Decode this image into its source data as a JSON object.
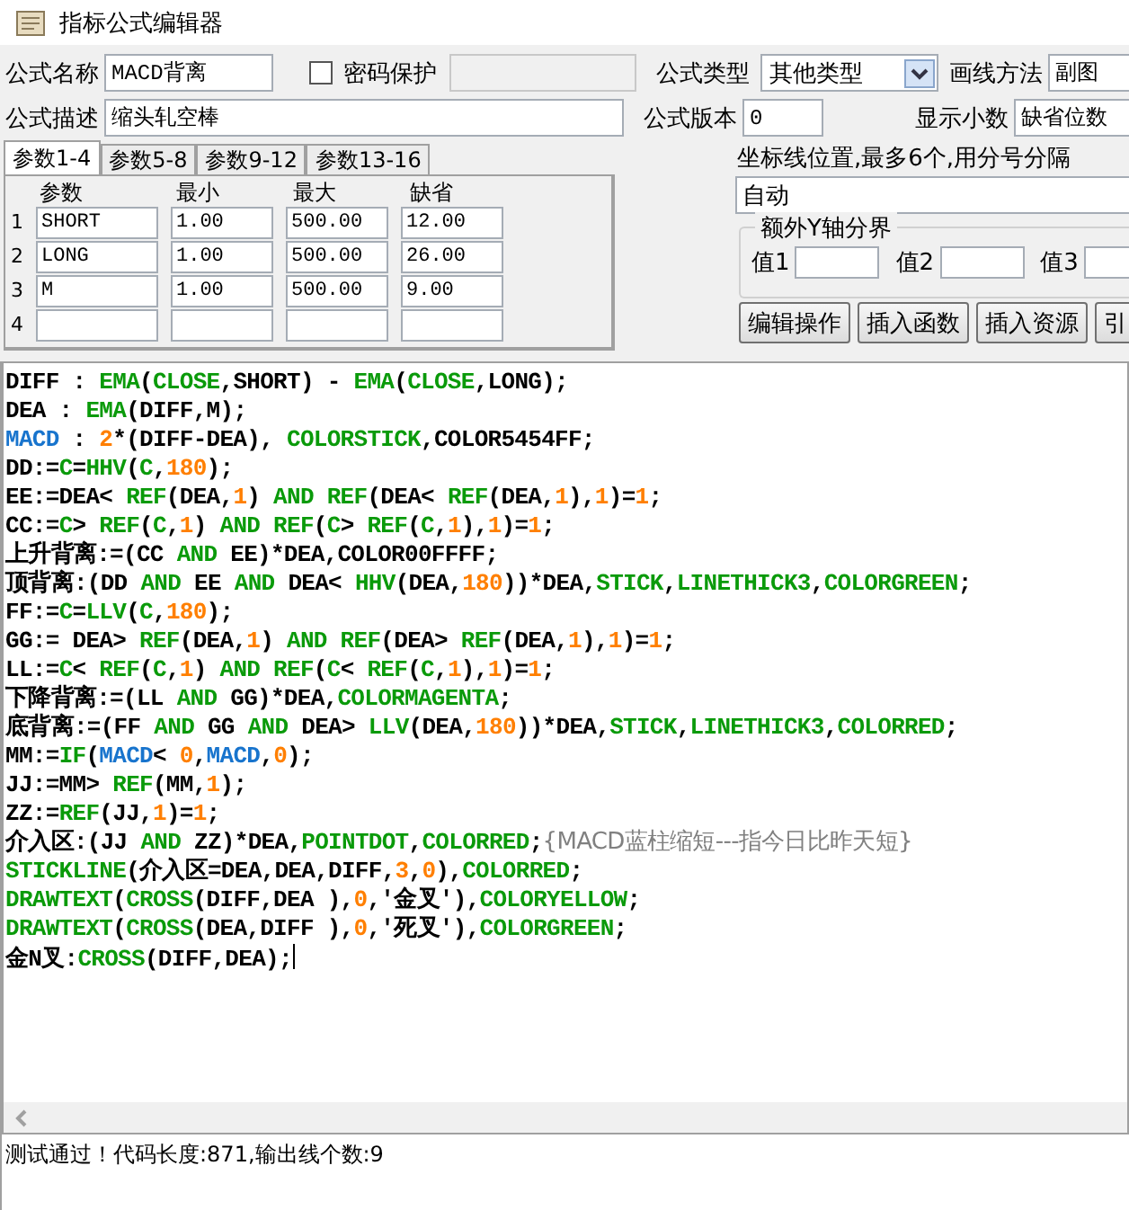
{
  "window": {
    "title": "指标公式编辑器"
  },
  "form": {
    "name_label": "公式名称",
    "name": "MACD背离",
    "password": {
      "label": "密码保护",
      "checked": false
    },
    "type_label": "公式类型",
    "type": "其他类型",
    "draw_label": "画线方法",
    "draw": "副图",
    "desc_label": "公式描述",
    "desc": "缩头轧空棒",
    "version_label": "公式版本",
    "version": "0",
    "decimals_label": "显示小数",
    "decimals": "缺省位数"
  },
  "param_tabs": [
    {
      "label": "参数1-4",
      "selected": true
    },
    {
      "label": "参数5-8",
      "selected": false
    },
    {
      "label": "参数9-12",
      "selected": false
    },
    {
      "label": "参数13-16",
      "selected": false
    }
  ],
  "param_table": {
    "columns": [
      "参数",
      "最小",
      "最大",
      "缺省"
    ],
    "rows": [
      {
        "index": "1",
        "cells": [
          "SHORT",
          "1.00",
          "500.00",
          "12.00"
        ]
      },
      {
        "index": "2",
        "cells": [
          "LONG",
          "1.00",
          "500.00",
          "26.00"
        ]
      },
      {
        "index": "3",
        "cells": [
          "M",
          "1.00",
          "500.00",
          "9.00"
        ]
      },
      {
        "index": "4"
      }
    ]
  },
  "axis": {
    "label": "坐标线位置,最多6个,用分号分隔",
    "value": "自动"
  },
  "y_split": {
    "title": "额外Y轴分界",
    "fields": [
      {
        "label": "值1"
      },
      {
        "label": "值2"
      },
      {
        "label": "值3"
      }
    ]
  },
  "buttons": [
    "编辑操作",
    "插入函数",
    "插入资源",
    "引"
  ],
  "code": [
    [
      {
        "kind": "plain",
        "text": "DIFF : "
      },
      {
        "kind": "func",
        "text": "EMA"
      },
      {
        "kind": "plain",
        "text": "("
      },
      {
        "kind": "func",
        "text": "CLOSE"
      },
      {
        "kind": "plain",
        "text": ",SHORT) - "
      },
      {
        "kind": "func",
        "text": "EMA"
      },
      {
        "kind": "plain",
        "text": "("
      },
      {
        "kind": "func",
        "text": "CLOSE"
      },
      {
        "kind": "plain",
        "text": ",LONG);"
      }
    ],
    [
      {
        "kind": "plain",
        "text": "DEA : "
      },
      {
        "kind": "func",
        "text": "EMA"
      },
      {
        "kind": "plain",
        "text": "(DIFF,M);"
      }
    ],
    [
      {
        "kind": "var",
        "text": "MACD"
      },
      {
        "kind": "plain",
        "text": " : "
      },
      {
        "kind": "num",
        "text": "2"
      },
      {
        "kind": "plain",
        "text": "*(DIFF-DEA), "
      },
      {
        "kind": "func",
        "text": "COLORSTICK"
      },
      {
        "kind": "plain",
        "text": ",COLOR5454FF;"
      }
    ],
    [
      {
        "kind": "plain",
        "text": "DD:="
      },
      {
        "kind": "func",
        "text": "C"
      },
      {
        "kind": "plain",
        "text": "="
      },
      {
        "kind": "func",
        "text": "HHV"
      },
      {
        "kind": "plain",
        "text": "("
      },
      {
        "kind": "func",
        "text": "C"
      },
      {
        "kind": "plain",
        "text": ","
      },
      {
        "kind": "num",
        "text": "180"
      },
      {
        "kind": "plain",
        "text": ");"
      }
    ],
    [
      {
        "kind": "plain",
        "text": "EE:=DEA< "
      },
      {
        "kind": "func",
        "text": "REF"
      },
      {
        "kind": "plain",
        "text": "(DEA,"
      },
      {
        "kind": "num",
        "text": "1"
      },
      {
        "kind": "plain",
        "text": ") "
      },
      {
        "kind": "func",
        "text": "AND REF"
      },
      {
        "kind": "plain",
        "text": "(DEA< "
      },
      {
        "kind": "func",
        "text": "REF"
      },
      {
        "kind": "plain",
        "text": "(DEA,"
      },
      {
        "kind": "num",
        "text": "1"
      },
      {
        "kind": "plain",
        "text": "),"
      },
      {
        "kind": "num",
        "text": "1"
      },
      {
        "kind": "plain",
        "text": ")="
      },
      {
        "kind": "num",
        "text": "1"
      },
      {
        "kind": "plain",
        "text": ";"
      }
    ],
    [
      {
        "kind": "plain",
        "text": "CC:="
      },
      {
        "kind": "func",
        "text": "C"
      },
      {
        "kind": "plain",
        "text": "> "
      },
      {
        "kind": "func",
        "text": "REF"
      },
      {
        "kind": "plain",
        "text": "("
      },
      {
        "kind": "func",
        "text": "C"
      },
      {
        "kind": "plain",
        "text": ","
      },
      {
        "kind": "num",
        "text": "1"
      },
      {
        "kind": "plain",
        "text": ") "
      },
      {
        "kind": "func",
        "text": "AND REF"
      },
      {
        "kind": "plain",
        "text": "("
      },
      {
        "kind": "func",
        "text": "C"
      },
      {
        "kind": "plain",
        "text": "> "
      },
      {
        "kind": "func",
        "text": "REF"
      },
      {
        "kind": "plain",
        "text": "("
      },
      {
        "kind": "func",
        "text": "C"
      },
      {
        "kind": "plain",
        "text": ","
      },
      {
        "kind": "num",
        "text": "1"
      },
      {
        "kind": "plain",
        "text": "),"
      },
      {
        "kind": "num",
        "text": "1"
      },
      {
        "kind": "plain",
        "text": ")="
      },
      {
        "kind": "num",
        "text": "1"
      },
      {
        "kind": "plain",
        "text": ";"
      }
    ],
    [
      {
        "kind": "plain",
        "text": "上升背离:=(CC "
      },
      {
        "kind": "func",
        "text": "AND"
      },
      {
        "kind": "plain",
        "text": " EE)*DEA,COLOR00FFFF;"
      }
    ],
    [
      {
        "kind": "plain",
        "text": "顶背离:(DD "
      },
      {
        "kind": "func",
        "text": "AND"
      },
      {
        "kind": "plain",
        "text": " EE "
      },
      {
        "kind": "func",
        "text": "AND"
      },
      {
        "kind": "plain",
        "text": " DEA< "
      },
      {
        "kind": "func",
        "text": "HHV"
      },
      {
        "kind": "plain",
        "text": "(DEA,"
      },
      {
        "kind": "num",
        "text": "180"
      },
      {
        "kind": "plain",
        "text": "))*DEA,"
      },
      {
        "kind": "func",
        "text": "STICK"
      },
      {
        "kind": "plain",
        "text": ","
      },
      {
        "kind": "func",
        "text": "LINETHICK3"
      },
      {
        "kind": "plain",
        "text": ","
      },
      {
        "kind": "func",
        "text": "COLORGREEN"
      },
      {
        "kind": "plain",
        "text": ";"
      }
    ],
    [
      {
        "kind": "plain",
        "text": "FF:="
      },
      {
        "kind": "func",
        "text": "C"
      },
      {
        "kind": "plain",
        "text": "="
      },
      {
        "kind": "func",
        "text": "LLV"
      },
      {
        "kind": "plain",
        "text": "("
      },
      {
        "kind": "func",
        "text": "C"
      },
      {
        "kind": "plain",
        "text": ","
      },
      {
        "kind": "num",
        "text": "180"
      },
      {
        "kind": "plain",
        "text": ");"
      }
    ],
    [
      {
        "kind": "plain",
        "text": "GG:= DEA> "
      },
      {
        "kind": "func",
        "text": "REF"
      },
      {
        "kind": "plain",
        "text": "(DEA,"
      },
      {
        "kind": "num",
        "text": "1"
      },
      {
        "kind": "plain",
        "text": ") "
      },
      {
        "kind": "func",
        "text": "AND REF"
      },
      {
        "kind": "plain",
        "text": "(DEA> "
      },
      {
        "kind": "func",
        "text": "REF"
      },
      {
        "kind": "plain",
        "text": "(DEA,"
      },
      {
        "kind": "num",
        "text": "1"
      },
      {
        "kind": "plain",
        "text": "),"
      },
      {
        "kind": "num",
        "text": "1"
      },
      {
        "kind": "plain",
        "text": ")="
      },
      {
        "kind": "num",
        "text": "1"
      },
      {
        "kind": "plain",
        "text": ";"
      }
    ],
    [
      {
        "kind": "plain",
        "text": "LL:="
      },
      {
        "kind": "func",
        "text": "C"
      },
      {
        "kind": "plain",
        "text": "< "
      },
      {
        "kind": "func",
        "text": "REF"
      },
      {
        "kind": "plain",
        "text": "("
      },
      {
        "kind": "func",
        "text": "C"
      },
      {
        "kind": "plain",
        "text": ","
      },
      {
        "kind": "num",
        "text": "1"
      },
      {
        "kind": "plain",
        "text": ") "
      },
      {
        "kind": "func",
        "text": "AND REF"
      },
      {
        "kind": "plain",
        "text": "("
      },
      {
        "kind": "func",
        "text": "C"
      },
      {
        "kind": "plain",
        "text": "< "
      },
      {
        "kind": "func",
        "text": "REF"
      },
      {
        "kind": "plain",
        "text": "("
      },
      {
        "kind": "func",
        "text": "C"
      },
      {
        "kind": "plain",
        "text": ","
      },
      {
        "kind": "num",
        "text": "1"
      },
      {
        "kind": "plain",
        "text": "),"
      },
      {
        "kind": "num",
        "text": "1"
      },
      {
        "kind": "plain",
        "text": ")="
      },
      {
        "kind": "num",
        "text": "1"
      },
      {
        "kind": "plain",
        "text": ";"
      }
    ],
    [
      {
        "kind": "plain",
        "text": "下降背离:=(LL "
      },
      {
        "kind": "func",
        "text": "AND"
      },
      {
        "kind": "plain",
        "text": " GG)*DEA,"
      },
      {
        "kind": "func",
        "text": "COLORMAGENTA"
      },
      {
        "kind": "plain",
        "text": ";"
      }
    ],
    [
      {
        "kind": "plain",
        "text": "底背离:=(FF "
      },
      {
        "kind": "func",
        "text": "AND"
      },
      {
        "kind": "plain",
        "text": " GG "
      },
      {
        "kind": "func",
        "text": "AND"
      },
      {
        "kind": "plain",
        "text": " DEA> "
      },
      {
        "kind": "func",
        "text": "LLV"
      },
      {
        "kind": "plain",
        "text": "(DEA,"
      },
      {
        "kind": "num",
        "text": "180"
      },
      {
        "kind": "plain",
        "text": "))*DEA,"
      },
      {
        "kind": "func",
        "text": "STICK"
      },
      {
        "kind": "plain",
        "text": ","
      },
      {
        "kind": "func",
        "text": "LINETHICK3"
      },
      {
        "kind": "plain",
        "text": ","
      },
      {
        "kind": "func",
        "text": "COLORRED"
      },
      {
        "kind": "plain",
        "text": ";"
      }
    ],
    [
      {
        "kind": "plain",
        "text": "MM:="
      },
      {
        "kind": "func",
        "text": "IF"
      },
      {
        "kind": "plain",
        "text": "("
      },
      {
        "kind": "var",
        "text": "MACD"
      },
      {
        "kind": "plain",
        "text": "< "
      },
      {
        "kind": "num",
        "text": "0"
      },
      {
        "kind": "plain",
        "text": ","
      },
      {
        "kind": "var",
        "text": "MACD"
      },
      {
        "kind": "plain",
        "text": ","
      },
      {
        "kind": "num",
        "text": "0"
      },
      {
        "kind": "plain",
        "text": ");"
      }
    ],
    [
      {
        "kind": "plain",
        "text": "JJ:=MM> "
      },
      {
        "kind": "func",
        "text": "REF"
      },
      {
        "kind": "plain",
        "text": "(MM,"
      },
      {
        "kind": "num",
        "text": "1"
      },
      {
        "kind": "plain",
        "text": ");"
      }
    ],
    [
      {
        "kind": "plain",
        "text": "ZZ:="
      },
      {
        "kind": "func",
        "text": "REF"
      },
      {
        "kind": "plain",
        "text": "(JJ,"
      },
      {
        "kind": "num",
        "text": "1"
      },
      {
        "kind": "plain",
        "text": ")="
      },
      {
        "kind": "num",
        "text": "1"
      },
      {
        "kind": "plain",
        "text": ";"
      }
    ],
    [
      {
        "kind": "plain",
        "text": "介入区:(JJ "
      },
      {
        "kind": "func",
        "text": "AND"
      },
      {
        "kind": "plain",
        "text": " ZZ)*DEA,"
      },
      {
        "kind": "func",
        "text": "POINTDOT"
      },
      {
        "kind": "plain",
        "text": ","
      },
      {
        "kind": "func",
        "text": "COLORRED"
      },
      {
        "kind": "plain",
        "text": ";"
      },
      {
        "kind": "comment",
        "text": "{MACD蓝柱缩短---指今日比昨天短}"
      }
    ],
    [
      {
        "kind": "func",
        "text": "STICKLINE"
      },
      {
        "kind": "plain",
        "text": "(介入区=DEA,DEA,DIFF,"
      },
      {
        "kind": "num",
        "text": "3"
      },
      {
        "kind": "plain",
        "text": ","
      },
      {
        "kind": "num",
        "text": "0"
      },
      {
        "kind": "plain",
        "text": "),"
      },
      {
        "kind": "func",
        "text": "COLORRED"
      },
      {
        "kind": "plain",
        "text": ";"
      }
    ],
    [
      {
        "kind": "func",
        "text": "DRAWTEXT"
      },
      {
        "kind": "plain",
        "text": "("
      },
      {
        "kind": "func",
        "text": "CROSS"
      },
      {
        "kind": "plain",
        "text": "(DIFF,DEA ),"
      },
      {
        "kind": "num",
        "text": "0"
      },
      {
        "kind": "plain",
        "text": ",'金叉'),"
      },
      {
        "kind": "func",
        "text": "COLORYELLOW"
      },
      {
        "kind": "plain",
        "text": ";"
      }
    ],
    [
      {
        "kind": "func",
        "text": "DRAWTEXT"
      },
      {
        "kind": "plain",
        "text": "("
      },
      {
        "kind": "func",
        "text": "CROSS"
      },
      {
        "kind": "plain",
        "text": "(DEA,DIFF ),"
      },
      {
        "kind": "num",
        "text": "0"
      },
      {
        "kind": "plain",
        "text": ",'死叉'),"
      },
      {
        "kind": "func",
        "text": "COLORGREEN"
      },
      {
        "kind": "plain",
        "text": ";"
      }
    ],
    [
      {
        "kind": "plain",
        "text": "金N叉:"
      },
      {
        "kind": "func",
        "text": "CROSS"
      },
      {
        "kind": "plain",
        "text": "(DIFF,DEA);"
      }
    ]
  ],
  "status": "测试通过！代码长度:871,输出线个数:9"
}
